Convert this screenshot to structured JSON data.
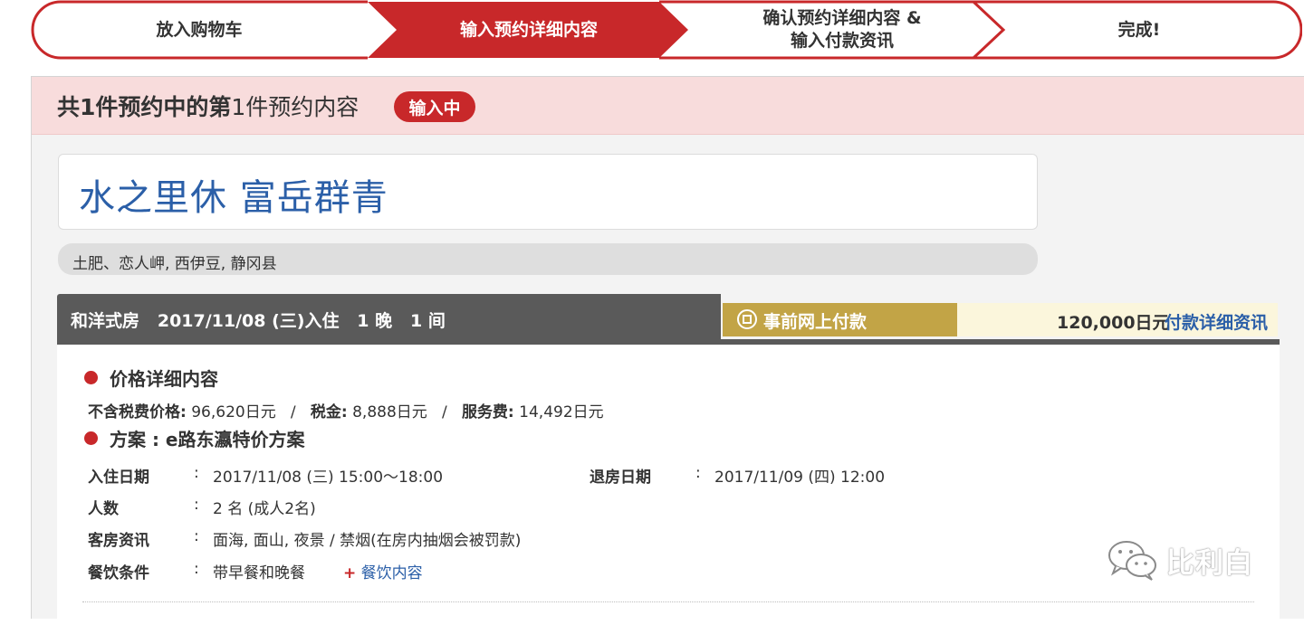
{
  "steps": [
    {
      "label": "放入购物车",
      "active": false
    },
    {
      "label": "输入预约详细内容",
      "active": true
    },
    {
      "label_line1": "确认预约详细内容 &",
      "label_line2": "输入付款资讯",
      "active": false
    },
    {
      "label": "完成!",
      "active": false
    }
  ],
  "header": {
    "title_bold": "共1件预约中的第",
    "title_rest": "1件预约内容",
    "status": "输入中"
  },
  "hotel": {
    "name": "水之里休 富岳群青",
    "address": "土肥、恋人岬, 西伊豆, 静冈县"
  },
  "room": {
    "summary": "和洋式房   2017/11/08 (三)入住   1 晚   1 间",
    "payment_method": "事前网上付款",
    "price": "120,000日元",
    "payment_details_link": "付款详细资讯"
  },
  "price_details": {
    "title": "价格详细内容",
    "pre_tax_label": "不含税费价格:",
    "pre_tax_value": "96,620日元",
    "tax_label": "税金:",
    "tax_value": "8,888日元",
    "service_label": "服务费:",
    "service_value": "14,492日元",
    "separator": "/"
  },
  "plan": {
    "title": "方案 : e路东瀛特价方案",
    "colon": ":",
    "checkin_label": "入住日期",
    "checkin_value": "2017/11/08 (三) 15:00～18:00",
    "checkout_label": "退房日期",
    "checkout_value": "2017/11/09 (四) 12:00",
    "guests_label": "人数",
    "guests_value": "2 名 (成人2名)",
    "room_info_label": "客房资讯",
    "room_info_value": "面海, 面山, 夜景 / 禁烟(在房内抽烟会被罚款)",
    "meal_label": "餐饮条件",
    "meal_value": "带早餐和晚餐",
    "meal_link_plus": "+",
    "meal_link": "餐饮内容"
  },
  "watermark": {
    "text": "比利白",
    "icon": "wechat-icon"
  },
  "colors": {
    "accent_red": "#c8282a",
    "link_blue": "#2b5fa8",
    "gold": "#c2a446",
    "header_pink": "#f8dcdc"
  }
}
